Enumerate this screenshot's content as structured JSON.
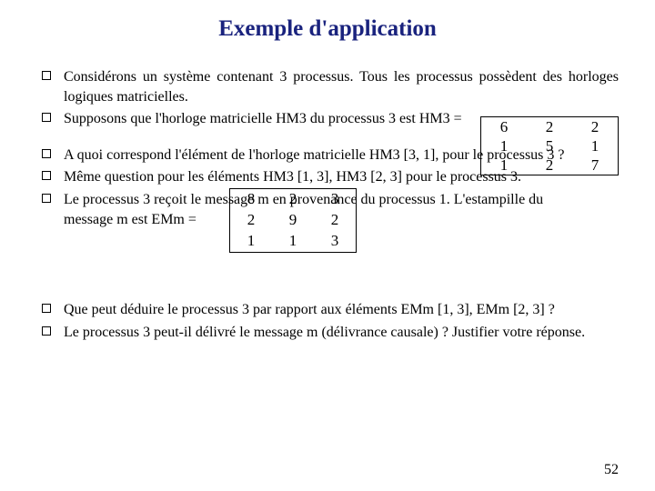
{
  "title": "Exemple d'application",
  "block1": {
    "b1": "Considérons un système contenant 3 processus. Tous les processus possèdent des horloges logiques matricielles.",
    "b2": "Supposons que l'horloge matricielle HM3 du processus 3 est HM3 ="
  },
  "matrix1": {
    "r1c1": "6",
    "r1c2": "2",
    "r1c3": "2",
    "r2c1": "1",
    "r2c2": "5",
    "r2c3": "1",
    "r3c1": "1",
    "r3c2": "2",
    "r3c3": "7"
  },
  "block2": {
    "b1": "A quoi correspond l'élément de l'horloge matricielle HM3 [3, 1], pour le processus 3 ?",
    "b2": "Même question pour les éléments HM3 [1, 3], HM3 [2, 3] pour le processus 3.",
    "b3a": "Le processus 3 reçoit le message m en provenance du processus 1. L'estampille du",
    "b3b": "message m est EMm ="
  },
  "matrix2": {
    "r1c1": "8",
    "r1c2": "2",
    "r1c3": "3",
    "r2c1": "2",
    "r2c2": "9",
    "r2c3": "2",
    "r3c1": "1",
    "r3c2": "1",
    "r3c3": "3"
  },
  "block3": {
    "b1": "Que peut déduire le processus 3 par rapport aux éléments EMm [1, 3], EMm [2, 3] ?",
    "b2": "Le processus 3 peut-il délivré le message m (délivrance causale) ? Justifier votre réponse."
  },
  "pagenum": "52"
}
